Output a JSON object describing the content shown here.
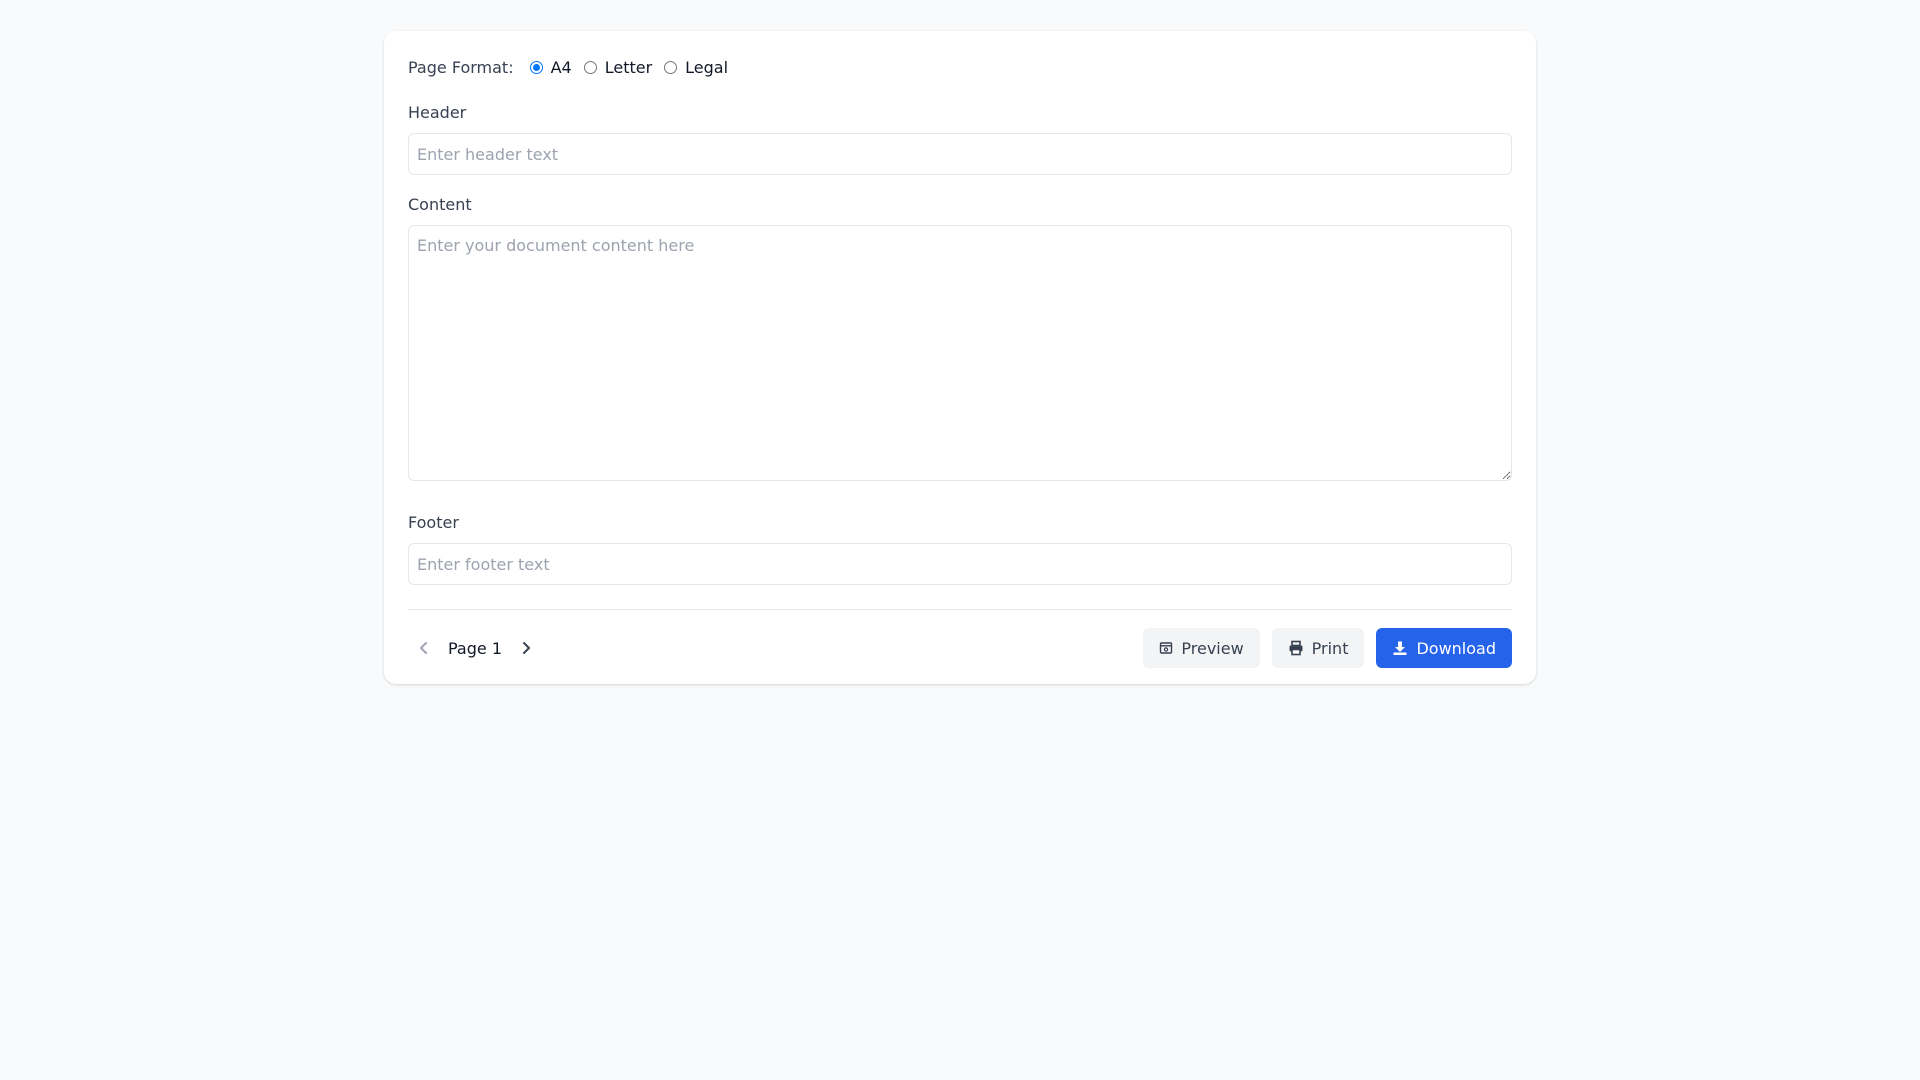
{
  "page_format": {
    "label": "Page Format:",
    "options": [
      {
        "label": "A4",
        "selected": true
      },
      {
        "label": "Letter",
        "selected": false
      },
      {
        "label": "Legal",
        "selected": false
      }
    ]
  },
  "header_field": {
    "label": "Header",
    "value": "",
    "placeholder": "Enter header text"
  },
  "content_field": {
    "label": "Content",
    "value": "",
    "placeholder": "Enter your document content here"
  },
  "footer_field": {
    "label": "Footer",
    "value": "",
    "placeholder": "Enter footer text"
  },
  "pagination": {
    "page_label": "Page 1",
    "prev_icon": "chevron-left-icon",
    "next_icon": "chevron-right-icon"
  },
  "actions": {
    "preview_label": "Preview",
    "print_label": "Print",
    "download_label": "Download"
  },
  "colors": {
    "primary": "#2563eb",
    "radio_accent": "#0075ff",
    "background": "#f9fafb"
  }
}
